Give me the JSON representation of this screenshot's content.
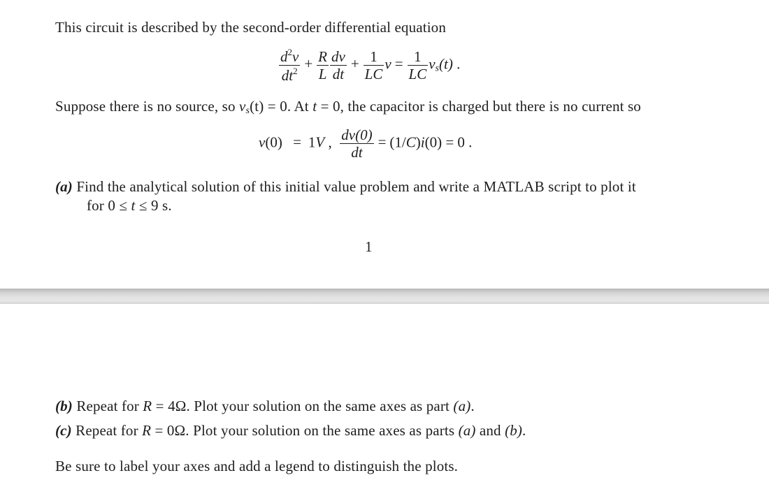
{
  "page1": {
    "intro": "This circuit is described by the second-order differential equation",
    "equation": {
      "term1": {
        "num": "d",
        "num_sup": "2",
        "num_var": "v",
        "den": "dt",
        "den_sup": "2"
      },
      "plus1": "+",
      "term2": {
        "coef_num": "R",
        "coef_den": "L",
        "num": "dv",
        "den": "dt"
      },
      "plus2": "+",
      "term3": {
        "num": "1",
        "den": "LC",
        "var": "v"
      },
      "equals": "=",
      "rhs": {
        "num": "1",
        "den": "LC",
        "var": "v",
        "sub": "s",
        "arg": "(t)",
        "end": "."
      }
    },
    "suppose_line": {
      "part1": "Suppose there is no source, so ",
      "vs": "v",
      "vs_sub": "s",
      "vs_rest": "(t) = 0.  At ",
      "t": "t",
      "rest": " = 0, the capacitor is charged but there is no current so"
    },
    "initial_conditions": {
      "v0": "v",
      "v0_arg": "(0)",
      "eq1": "=",
      "val1": "1",
      "unit1": "V",
      "comma": ",",
      "frac_num": "dv(0)",
      "frac_den": "dt",
      "eq2": "=",
      "rhs_a": "(1/",
      "rhs_C": "C",
      "rhs_b": ")",
      "rhs_i": "i",
      "rhs_c": "(0) = 0 ."
    },
    "part_a": {
      "label": "(a)",
      "line1": "Find the analytical solution of this initial value problem and write a MATLAB script to plot it",
      "line2_pre": "for 0 ≤ ",
      "line2_t": "t",
      "line2_post": " ≤ 9 s."
    },
    "page_number": "1"
  },
  "page2": {
    "part_b": {
      "label": "(b)",
      "pre": "Repeat for ",
      "R": "R",
      "mid": " = 4Ω. Plot your solution on the same axes as part ",
      "ref1": "(a)",
      "end": "."
    },
    "part_c": {
      "label": "(c)",
      "pre": "Repeat for ",
      "R": "R",
      "mid": " = 0Ω. Plot your solution on the same axes as parts ",
      "ref1": "(a)",
      "and": " and ",
      "ref2": "(b)",
      "end": "."
    },
    "closing": "Be sure to label your axes and add a legend to distinguish the plots."
  }
}
